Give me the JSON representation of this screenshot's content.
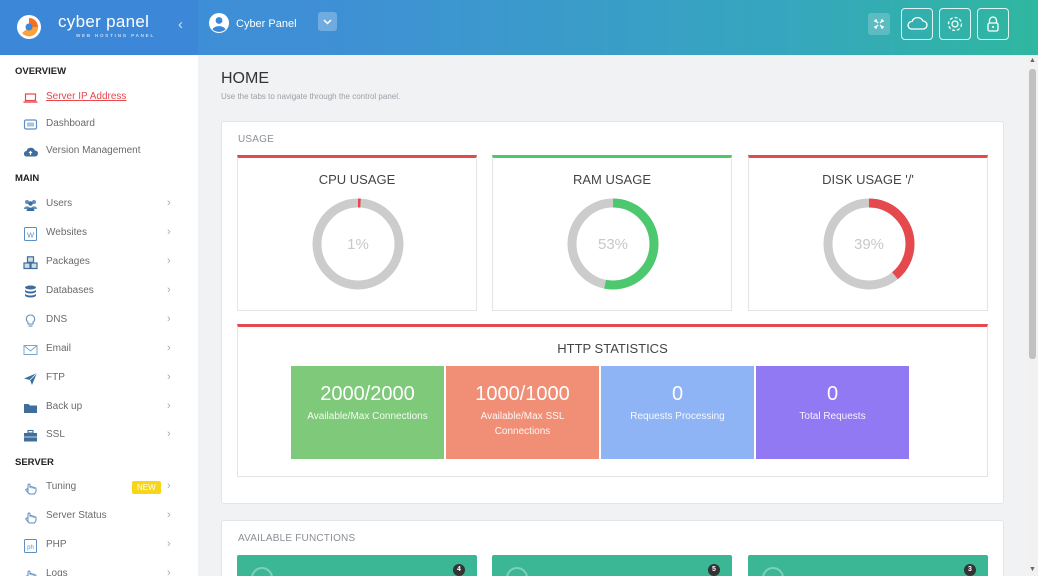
{
  "header": {
    "brand_name": "cyber panel",
    "brand_tagline": "WEB HOSTING PANEL",
    "user_name": "Cyber Panel",
    "accent": "#3d87d8"
  },
  "sidebar": {
    "sections": {
      "overview": "OVERVIEW",
      "main": "MAIN",
      "server": "SERVER"
    },
    "overview_items": [
      {
        "label": "Server IP Address",
        "icon": "laptop-icon",
        "active": true
      },
      {
        "label": "Dashboard",
        "icon": "monitor-icon"
      },
      {
        "label": "Version Management",
        "icon": "cloud-upload-icon"
      }
    ],
    "main_items": [
      {
        "label": "Users",
        "icon": "users-icon"
      },
      {
        "label": "Websites",
        "icon": "wordpress-icon"
      },
      {
        "label": "Packages",
        "icon": "cubes-icon"
      },
      {
        "label": "Databases",
        "icon": "database-icon"
      },
      {
        "label": "DNS",
        "icon": "lightbulb-icon"
      },
      {
        "label": "Email",
        "icon": "envelope-icon"
      },
      {
        "label": "FTP",
        "icon": "paper-plane-icon"
      },
      {
        "label": "Back up",
        "icon": "folder-icon"
      },
      {
        "label": "SSL",
        "icon": "briefcase-icon"
      }
    ],
    "server_items": [
      {
        "label": "Tuning",
        "icon": "hand-pointer-icon",
        "badge": "NEW"
      },
      {
        "label": "Server Status",
        "icon": "hand-pointer-icon"
      },
      {
        "label": "PHP",
        "icon": "php-icon"
      },
      {
        "label": "Logs",
        "icon": "hand-pointer-icon"
      }
    ]
  },
  "page": {
    "title": "HOME",
    "subtitle": "Use the tabs to navigate through the control panel."
  },
  "usage": {
    "heading": "USAGE",
    "gauges": [
      {
        "title": "CPU USAGE",
        "value": 1,
        "display": "1%",
        "color": "#e5484d",
        "top_color": "#e5484d"
      },
      {
        "title": "RAM USAGE",
        "value": 53,
        "display": "53%",
        "color": "#4cc86f",
        "top_color": "#4cc86f"
      },
      {
        "title": "DISK USAGE '/'",
        "value": 39,
        "display": "39%",
        "color": "#e5484d",
        "top_color": "#e5484d"
      }
    ]
  },
  "http": {
    "title": "HTTP STATISTICS",
    "stats": [
      {
        "value": "2000/2000",
        "label": "Available/Max Connections",
        "color": "#7fc97a"
      },
      {
        "value": "1000/1000",
        "label": "Available/Max SSL Connections",
        "color": "#f08f75"
      },
      {
        "value": "0",
        "label": "Requests Processing",
        "color": "#8fb4f5"
      },
      {
        "value": "0",
        "label": "Total Requests",
        "color": "#9079f2"
      }
    ]
  },
  "functions": {
    "heading": "AVAILABLE FUNCTIONS",
    "cards": [
      {
        "badge": "4"
      },
      {
        "badge": "5"
      },
      {
        "badge": "3"
      }
    ]
  }
}
